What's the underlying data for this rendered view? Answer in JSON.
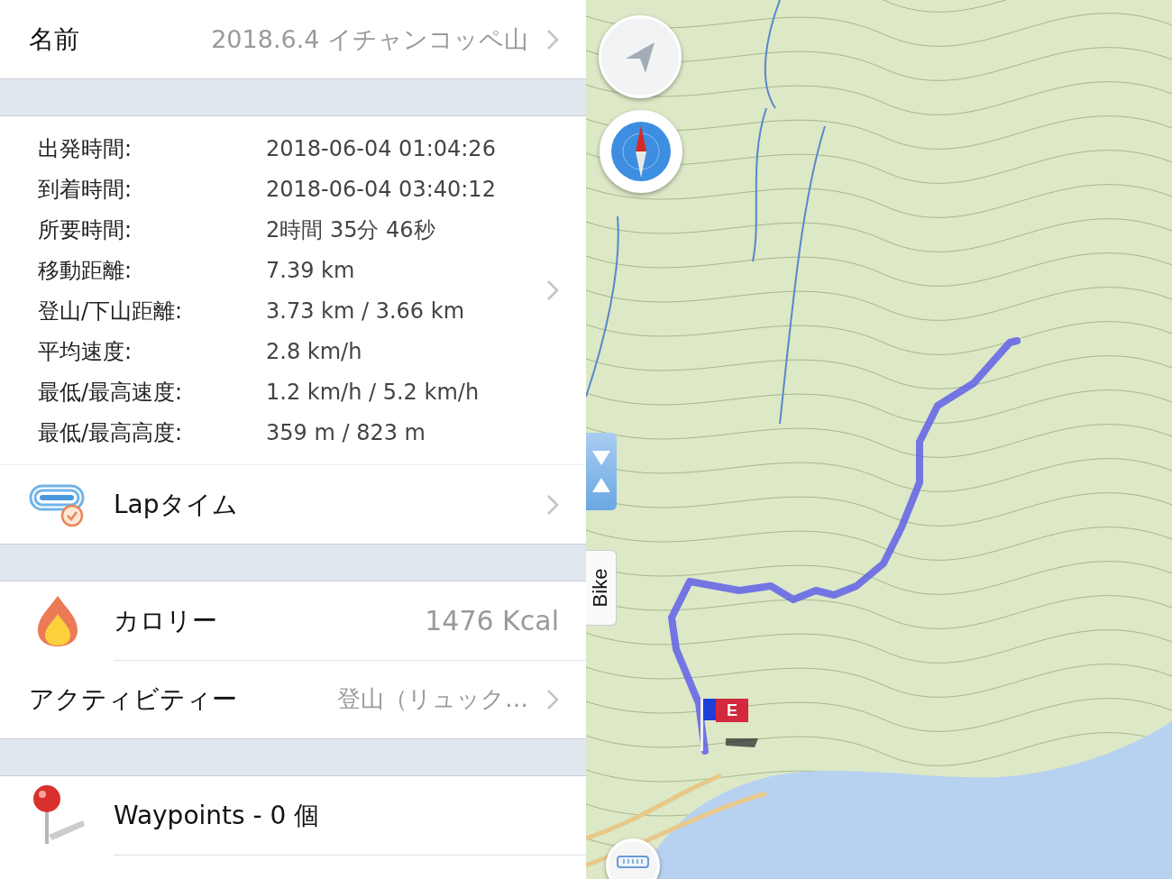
{
  "name_row": {
    "label": "名前",
    "value": "2018.6.4 イチャンコッペ山"
  },
  "stats": [
    {
      "label": "出発時間:",
      "value": "2018-06-04 01:04:26"
    },
    {
      "label": "到着時間:",
      "value": "2018-06-04 03:40:12"
    },
    {
      "label": "所要時間:",
      "value": "2時間 35分 46秒"
    },
    {
      "label": "移動距離:",
      "value": "7.39 km"
    },
    {
      "label": "登山/下山距離:",
      "value": "3.73 km / 3.66 km"
    },
    {
      "label": "平均速度:",
      "value": "2.8 km/h"
    },
    {
      "label": "最低/最高速度:",
      "value": "1.2 km/h / 5.2 km/h"
    },
    {
      "label": "最低/最高高度:",
      "value": "359 m / 823 m"
    }
  ],
  "lap": {
    "label": "Lapタイム"
  },
  "calories": {
    "label": "カロリー",
    "value": "1476 Kcal"
  },
  "activity": {
    "label": "アクティビティー",
    "value": "登山（リュック…"
  },
  "waypoints": {
    "label": "Waypoints - 0 個"
  },
  "map": {
    "mode_tab": "Bike",
    "flag_label": "E"
  }
}
